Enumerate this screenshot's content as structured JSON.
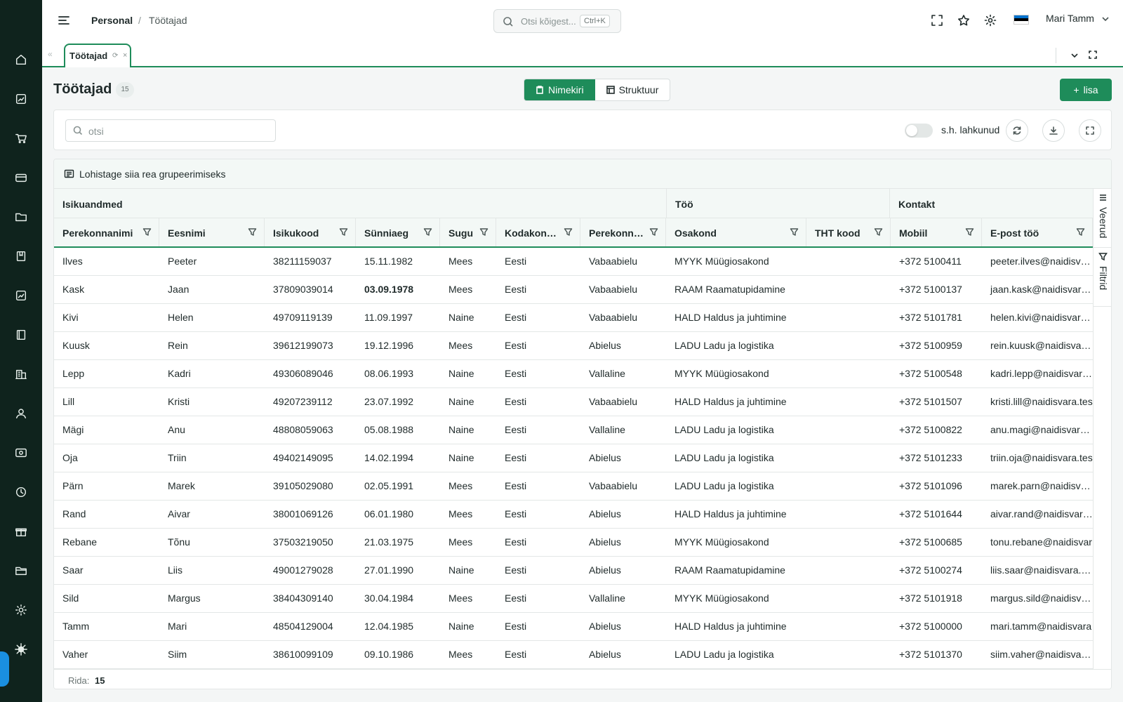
{
  "header": {
    "breadcrumb": [
      "Personal",
      "Töötajad"
    ],
    "breadcrumb_sep": "/",
    "search_placeholder": "Otsi kõigest...",
    "search_shortcut": "Ctrl+K",
    "user_name": "Mari Tamm",
    "flag_colors": [
      "#0072ce",
      "#000000",
      "#ffffff"
    ]
  },
  "tabs": [
    {
      "label": "Töötajad",
      "active": true
    }
  ],
  "page": {
    "title": "Töötajad",
    "count": "15",
    "view_list": "Nimekiri",
    "view_structure": "Struktuur",
    "add_label": "lisa"
  },
  "filters": {
    "search_placeholder": "otsi",
    "toggle_label": "s.h. lahkunud",
    "toggle_on": false
  },
  "grid": {
    "group_hint": "Lohistage siia rea grupeerimiseks",
    "column_groups": [
      "Isikuandmed",
      "Töö",
      "Kontakt"
    ],
    "columns": [
      "Perekonnanimi",
      "Eesnimi",
      "Isikukood",
      "Sünniaeg",
      "Sugu",
      "Kodakonds...",
      "Perekonna...",
      "Osakond",
      "THT kood",
      "Mobiil",
      "E-post töö"
    ],
    "rows": [
      [
        "Ilves",
        "Peeter",
        "38211159037",
        "15.11.1982",
        "Mees",
        "Eesti",
        "Vabaabielu",
        "MYYK Müügiosakond",
        "",
        "+372 5100411",
        "peeter.ilves@naidisvar..."
      ],
      [
        "Kask",
        "Jaan",
        "37809039014",
        "03.09.1978",
        "Mees",
        "Eesti",
        "Vabaabielu",
        "RAAM Raamatupidamine",
        "",
        "+372 5100137",
        "jaan.kask@naidisvara.t..."
      ],
      [
        "Kivi",
        "Helen",
        "49709119139",
        "11.09.1997",
        "Naine",
        "Eesti",
        "Vabaabielu",
        "HALD Haldus ja juhtimine",
        "",
        "+372 5101781",
        "helen.kivi@naidisvara.t..."
      ],
      [
        "Kuusk",
        "Rein",
        "39612199073",
        "19.12.1996",
        "Mees",
        "Eesti",
        "Abielus",
        "LADU Ladu ja logistika",
        "",
        "+372 5100959",
        "rein.kuusk@naidisvara..."
      ],
      [
        "Lepp",
        "Kadri",
        "49306089046",
        "08.06.1993",
        "Naine",
        "Eesti",
        "Vallaline",
        "MYYK Müügiosakond",
        "",
        "+372 5100548",
        "kadri.lepp@naidisvara..."
      ],
      [
        "Lill",
        "Kristi",
        "49207239112",
        "23.07.1992",
        "Naine",
        "Eesti",
        "Vabaabielu",
        "HALD Haldus ja juhtimine",
        "",
        "+372 5101507",
        "kristi.lill@naidisvara.tes"
      ],
      [
        "Mägi",
        "Anu",
        "48808059063",
        "05.08.1988",
        "Naine",
        "Eesti",
        "Vallaline",
        "LADU Ladu ja logistika",
        "",
        "+372 5100822",
        "anu.magi@naidisvara.t..."
      ],
      [
        "Oja",
        "Triin",
        "49402149095",
        "14.02.1994",
        "Naine",
        "Eesti",
        "Abielus",
        "LADU Ladu ja logistika",
        "",
        "+372 5101233",
        "triin.oja@naidisvara.tes"
      ],
      [
        "Pärn",
        "Marek",
        "39105029080",
        "02.05.1991",
        "Mees",
        "Eesti",
        "Vabaabielu",
        "LADU Ladu ja logistika",
        "",
        "+372 5101096",
        "marek.parn@naidisvar..."
      ],
      [
        "Rand",
        "Aivar",
        "38001069126",
        "06.01.1980",
        "Mees",
        "Eesti",
        "Abielus",
        "HALD Haldus ja juhtimine",
        "",
        "+372 5101644",
        "aivar.rand@naidisvara..."
      ],
      [
        "Rebane",
        "Tõnu",
        "37503219050",
        "21.03.1975",
        "Mees",
        "Eesti",
        "Abielus",
        "MYYK Müügiosakond",
        "",
        "+372 5100685",
        "tonu.rebane@naidisvar"
      ],
      [
        "Saar",
        "Liis",
        "49001279028",
        "27.01.1990",
        "Naine",
        "Eesti",
        "Abielus",
        "RAAM Raamatupidamine",
        "",
        "+372 5100274",
        "liis.saar@naidisvara.tes"
      ],
      [
        "Sild",
        "Margus",
        "38404309140",
        "30.04.1984",
        "Mees",
        "Eesti",
        "Vallaline",
        "MYYK Müügiosakond",
        "",
        "+372 5101918",
        "margus.sild@naidisvar..."
      ],
      [
        "Tamm",
        "Mari",
        "48504129004",
        "12.04.1985",
        "Naine",
        "Eesti",
        "Abielus",
        "HALD Haldus ja juhtimine",
        "",
        "+372 5100000",
        "mari.tamm@naidisvara"
      ],
      [
        "Vaher",
        "Siim",
        "38610099109",
        "09.10.1986",
        "Mees",
        "Eesti",
        "Abielus",
        "LADU Ladu ja logistika",
        "",
        "+372 5101370",
        "siim.vaher@naidisvara..."
      ]
    ],
    "bold_cell": {
      "row": 1,
      "col": 3
    },
    "side_tabs": [
      "Veerud",
      "Filtrid"
    ],
    "footer_label": "Rida:",
    "footer_count": "15"
  },
  "sidebar_icons": [
    "home-icon",
    "chart-icon",
    "cart-icon",
    "card-icon",
    "folder-icon",
    "book-icon",
    "analytics-icon",
    "ledger-icon",
    "building-icon",
    "person-icon",
    "payroll-icon",
    "clock-icon",
    "gift-icon",
    "folder-open-icon",
    "settings-icon",
    "gear-icon"
  ]
}
